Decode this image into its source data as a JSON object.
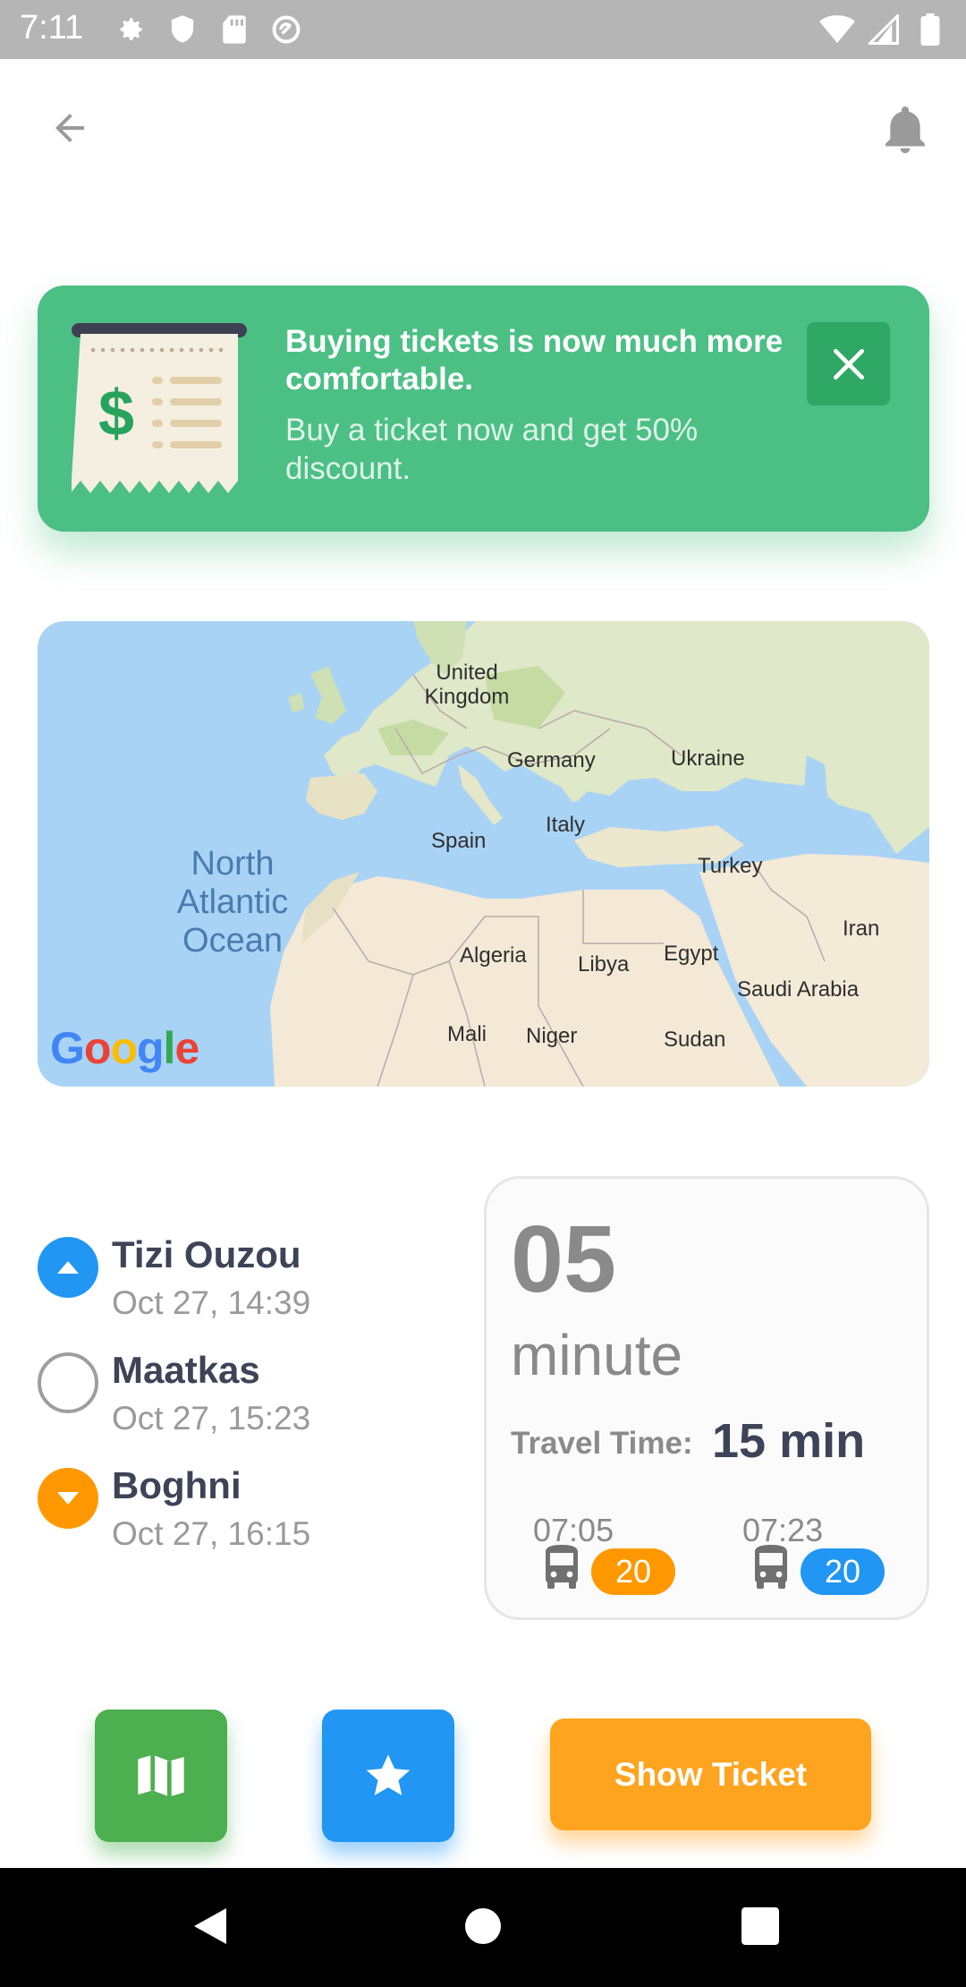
{
  "status_bar": {
    "time": "7:11",
    "left_icons": [
      "gear-icon",
      "shield-icon",
      "sd-card-icon",
      "sync-icon"
    ],
    "right_icons": [
      "wifi-icon",
      "signal-icon",
      "battery-icon"
    ]
  },
  "top_bar": {
    "back_icon": "arrow-left-icon",
    "bell_icon": "bell-icon"
  },
  "promo": {
    "title": "Buying tickets is now much more comfortable.",
    "subtitle": "Buy a ticket now and get 50% discount.",
    "close_icon": "close-icon",
    "receipt_symbol": "$",
    "color": "#4cbf85"
  },
  "map": {
    "ocean": "North Atlantic Ocean",
    "labels": {
      "uk": "United Kingdom",
      "germany": "Germany",
      "ukraine": "Ukraine",
      "spain": "Spain",
      "italy": "Italy",
      "turkey": "Turkey",
      "iran": "Iran",
      "algeria": "Algeria",
      "libya": "Libya",
      "egypt": "Egypt",
      "saudi": "Saudi Arabia",
      "mali": "Mali",
      "niger": "Niger",
      "sudan": "Sudan"
    },
    "google": [
      "G",
      "o",
      "o",
      "g",
      "l",
      "e"
    ]
  },
  "stops": [
    {
      "name": "Tizi Ouzou",
      "time": "Oct 27, 14:39",
      "icon": "chevron-up-icon",
      "color": "#2196f3"
    },
    {
      "name": "Maatkas",
      "time": "Oct 27, 15:23",
      "icon": "circle-outline-icon",
      "color": "#9e9e9e"
    },
    {
      "name": "Boghni",
      "time": "Oct 27, 16:15",
      "icon": "chevron-down-icon",
      "color": "#ff9800"
    }
  ],
  "time_card": {
    "countdown": "05",
    "unit": "minute",
    "travel_label": "Travel Time:",
    "travel_value": "15 min",
    "departures": [
      {
        "time": "07:05",
        "bus_number": "20",
        "color": "#ff9800"
      },
      {
        "time": "07:23",
        "bus_number": "20",
        "color": "#2196f3"
      }
    ]
  },
  "actions": {
    "map_icon": "map-icon",
    "star_icon": "star-icon",
    "show_ticket": "Show Ticket"
  },
  "nav_bar": [
    "back-triangle-icon",
    "home-circle-icon",
    "recents-square-icon"
  ]
}
